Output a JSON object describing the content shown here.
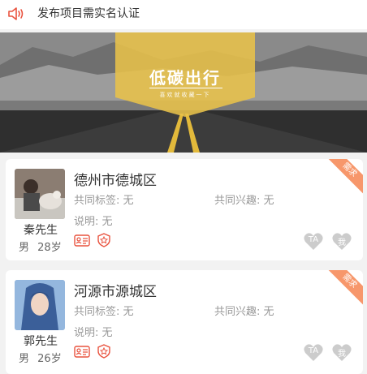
{
  "notice": {
    "text": "发布项目需实名认证",
    "icon": "speaker-icon",
    "color": "#e9533f"
  },
  "banner": {
    "title": "低碳出行",
    "subtitle": "喜欢就收藏一下"
  },
  "cards": [
    {
      "location": "德州市德城区",
      "tags_label": "共同标签: 无",
      "interest_label": "共同兴趣: 无",
      "desc_label": "说明: 无",
      "name": "秦先生",
      "gender": "男",
      "age": "28岁",
      "badge": "需求",
      "heart_ta": "TA",
      "heart_me": "我"
    },
    {
      "location": "河源市源城区",
      "tags_label": "共同标签: 无",
      "interest_label": "共同兴趣: 无",
      "desc_label": "说明: 无",
      "name": "郭先生",
      "gender": "男",
      "age": "26岁",
      "badge": "需求",
      "heart_ta": "TA",
      "heart_me": "我"
    }
  ],
  "colors": {
    "accent": "#e9533f",
    "ribbon": "#e8c24a",
    "tag": "#f7976b",
    "heart": "#cccccc"
  }
}
